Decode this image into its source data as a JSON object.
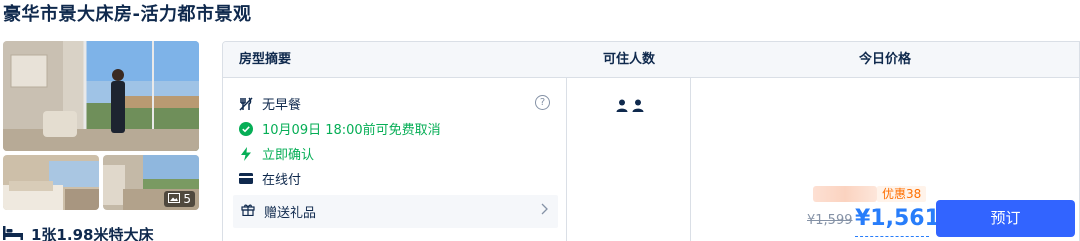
{
  "room": {
    "title": "豪华市景大床房-活力都市景观",
    "bed": "1张1.98米特大床",
    "photo_count": "5"
  },
  "table": {
    "headers": {
      "summary": "房型摘要",
      "occupancy": "可住人数",
      "price": "今日价格"
    },
    "features": {
      "breakfast": "无早餐",
      "cancel": "10月09日 18:00前可免费取消",
      "confirm": "立即确认",
      "payment": "在线付"
    },
    "gift": "赠送礼品",
    "occupancy_count": 2,
    "price": {
      "promo": "优惠38",
      "original": "¥1,599",
      "current": "¥1,561"
    },
    "book_label": "预订"
  },
  "colors": {
    "accent_blue": "#287dfa",
    "button_blue": "#3264ff",
    "green": "#06ae56",
    "promo_orange": "#ff6f00",
    "text_dark": "#0f294d"
  }
}
